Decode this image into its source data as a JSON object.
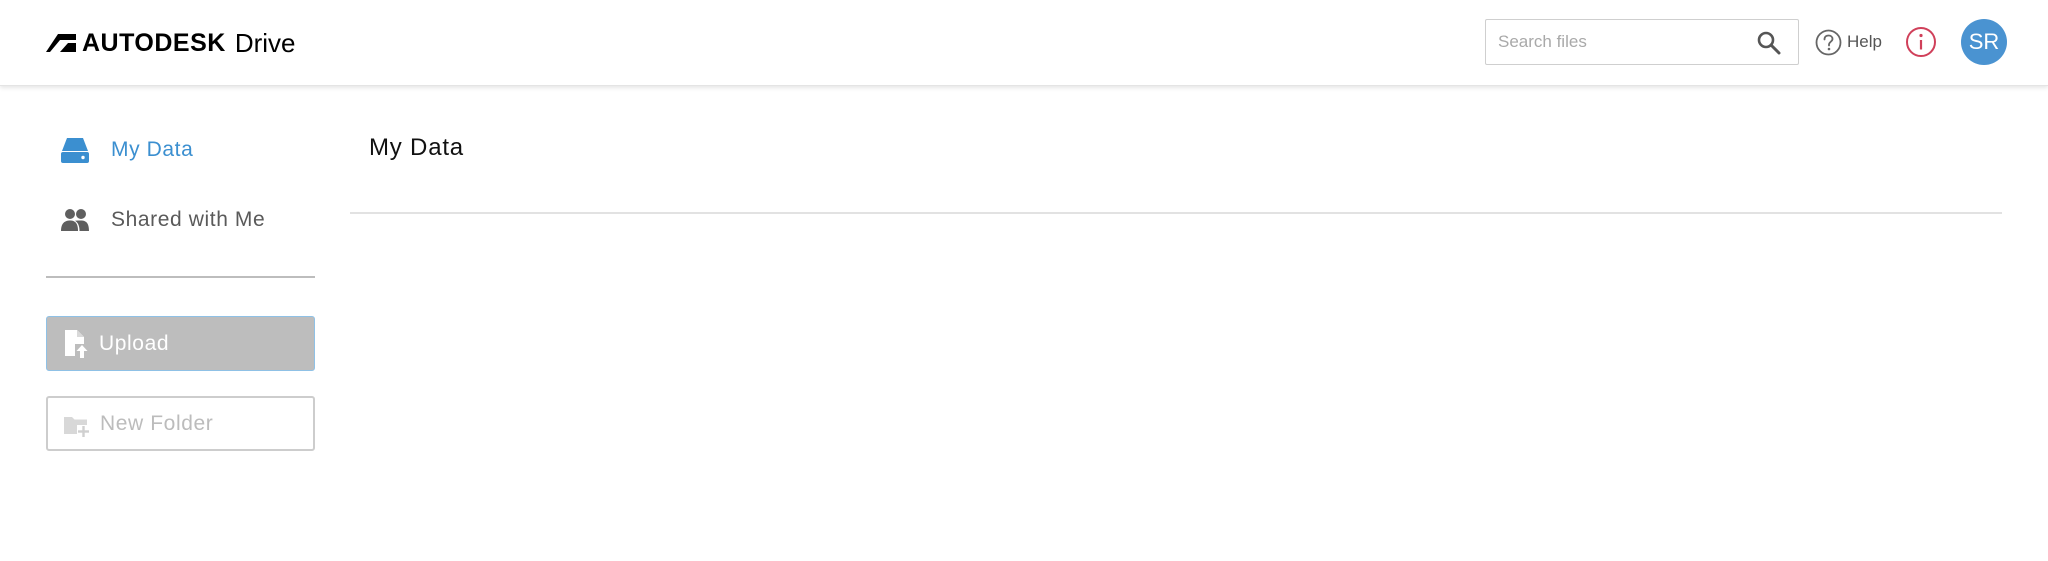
{
  "header": {
    "brand": "AUTODESK",
    "product": "Drive",
    "search": {
      "placeholder": "Search files",
      "value": ""
    },
    "help_label": "Help",
    "avatar_initials": "SR"
  },
  "sidebar": {
    "items": [
      {
        "label": "My Data",
        "icon": "drive-icon",
        "active": true
      },
      {
        "label": "Shared with Me",
        "icon": "people-icon",
        "active": false
      }
    ],
    "upload_label": "Upload",
    "new_folder_label": "New Folder"
  },
  "main": {
    "title": "My Data"
  },
  "colors": {
    "accent": "#3b8fd0",
    "avatar": "#4a93d1",
    "upload_button": "#bdbdbd",
    "info_icon": "#d0405a"
  }
}
